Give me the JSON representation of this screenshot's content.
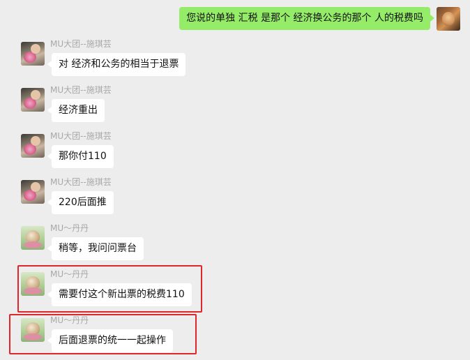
{
  "self_message": {
    "text": "您说的单独 汇税 是那个 经济换公务的那个 人的税费吗"
  },
  "messages": [
    {
      "sender": "MU大团--施琪芸",
      "text": "对 经济和公务的相当于退票",
      "avatar": "shi"
    },
    {
      "sender": "MU大团--施琪芸",
      "text": "经济重出",
      "avatar": "shi"
    },
    {
      "sender": "MU大团--施琪芸",
      "text": "那你付110",
      "avatar": "shi"
    },
    {
      "sender": "MU大团--施琪芸",
      "text": "220后面推",
      "avatar": "shi"
    },
    {
      "sender": "MU～丹丹",
      "text": "稍等，我问问票台",
      "avatar": "dan"
    },
    {
      "sender": "MU～丹丹",
      "text": "需要付这个新出票的税费110",
      "avatar": "dan"
    },
    {
      "sender": "MU～丹丹",
      "text": "后面退票的统一一起操作",
      "avatar": "dan"
    }
  ],
  "colors": {
    "self_bubble": "#95ec69",
    "other_bubble": "#ffffff",
    "background": "#ededed",
    "highlight": "#e0262c"
  }
}
